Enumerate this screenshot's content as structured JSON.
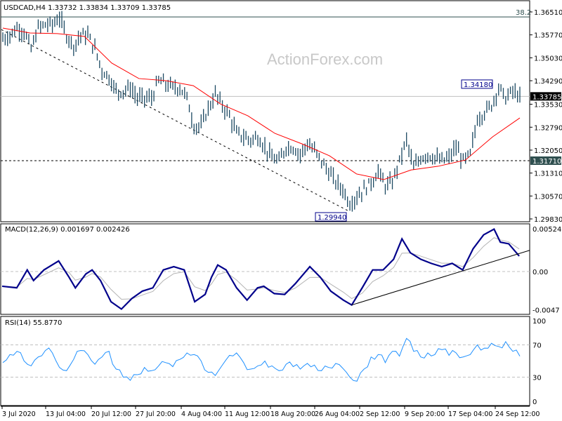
{
  "header": {
    "symbol_info": "USDCAD,H4  1.33732 1.33834 1.33709 1.33785"
  },
  "watermark": "ActionForex.com",
  "colors": {
    "bars": "#1d4a63",
    "ma": "#ff0000",
    "macd": "#00008b",
    "signal": "#b4b4b4",
    "rsi": "#1e90ff",
    "current_price_bg": "#000000",
    "level_bg": "#2f4f4f"
  },
  "chart_data": [
    {
      "type": "line",
      "title": "USDCAD,H4",
      "price_axis_ticks": [
        "1.36510",
        "1.35770",
        "1.35030",
        "1.34290",
        "1.33530",
        "1.32790",
        "1.32050",
        "1.31310",
        "1.30570",
        "1.29830"
      ],
      "price_axis_values": [
        1.3651,
        1.3577,
        1.3503,
        1.3429,
        1.3353,
        1.3279,
        1.3205,
        1.3131,
        1.3057,
        1.2983
      ],
      "ylim": [
        1.2983,
        1.3651
      ],
      "time_labels": [
        "3 Jul 2020",
        "13 Jul 04:00",
        "20 Jul 12:00",
        "27 Jul 20:00",
        "4 Aug 04:00",
        "11 Aug 12:00",
        "18 Aug 20:00",
        "26 Aug 04:00",
        "2 Sep 12:00",
        "9 Sep 20:00",
        "17 Sep 04:00",
        "24 Sep 12:00"
      ],
      "closes": [
        1.3565,
        1.3576,
        1.3599,
        1.3588,
        1.3531,
        1.3599,
        1.361,
        1.361,
        1.3633,
        1.3576,
        1.3542,
        1.3576,
        1.3576,
        1.3531,
        1.3463,
        1.344,
        1.3395,
        1.3395,
        1.3407,
        1.3373,
        1.3373,
        1.3373,
        1.3429,
        1.3418,
        1.3407,
        1.3407,
        1.3373,
        1.3282,
        1.3282,
        1.3339,
        1.3384,
        1.335,
        1.3316,
        1.3259,
        1.3248,
        1.3237,
        1.3248,
        1.3214,
        1.318,
        1.3169,
        1.3214,
        1.3214,
        1.3191,
        1.3225,
        1.3203,
        1.3169,
        1.3135,
        1.3101,
        1.3078,
        1.3033,
        1.3056,
        1.3078,
        1.3101,
        1.3135,
        1.309,
        1.3101,
        1.3169,
        1.3237,
        1.3146,
        1.318,
        1.3191,
        1.318,
        1.3169,
        1.318,
        1.3214,
        1.3169,
        1.3191,
        1.3305,
        1.3327,
        1.335,
        1.3407,
        1.3373,
        1.3395,
        1.3377
      ],
      "moving_average": [
        1.3599,
        1.3583,
        1.3581,
        1.3572,
        1.3486,
        1.3436,
        1.3429,
        1.3413,
        1.3354,
        1.3316,
        1.3259,
        1.3225,
        1.3187,
        1.3128,
        1.311,
        1.3141,
        1.3153,
        1.3173,
        1.3248,
        1.3309
      ],
      "current_price": {
        "label": "1.33785",
        "value": 1.33785
      },
      "level_line": {
        "label": "1.31710",
        "value": 1.3171
      },
      "fib_line": {
        "label": "38.2",
        "value": 1.3635
      },
      "high_annotation": {
        "label": "1.34180",
        "value": 1.3418
      },
      "low_annotation": {
        "label": "1.29940",
        "value": 1.2994
      },
      "trendline": {
        "from": 1.3594,
        "to": 1.301
      }
    },
    {
      "type": "line",
      "title": "MACD(12,26,9) 0.001697 0.002426",
      "axis_ticks": [
        "0.005245",
        "0.00",
        "-0.0047"
      ],
      "ylim": [
        -0.0047,
        0.005245
      ],
      "signal_period": 9,
      "macd": [
        [
          0,
          -0.0018
        ],
        [
          7,
          -0.002
        ],
        [
          12,
          0.0002
        ],
        [
          15,
          -0.0011
        ],
        [
          20,
          0.0002
        ],
        [
          27,
          0.0013
        ],
        [
          32,
          -0.0007
        ],
        [
          35,
          -0.002
        ],
        [
          40,
          -0.0003
        ],
        [
          43,
          0.0002
        ],
        [
          47,
          -0.0011
        ],
        [
          52,
          -0.0037
        ],
        [
          57,
          -0.0046
        ],
        [
          62,
          -0.0033
        ],
        [
          67,
          -0.0024
        ],
        [
          72,
          -0.002
        ],
        [
          77,
          0.0002
        ],
        [
          82,
          0.0006
        ],
        [
          87,
          0.0002
        ],
        [
          92,
          -0.0037
        ],
        [
          97,
          -0.0028
        ],
        [
          100,
          -0.0007
        ],
        [
          103,
          0.0008
        ],
        [
          107,
          0.0002
        ],
        [
          112,
          -0.002
        ],
        [
          117,
          -0.0035
        ],
        [
          122,
          -0.002
        ],
        [
          125,
          -0.0018
        ],
        [
          130,
          -0.0027
        ],
        [
          135,
          -0.0028
        ],
        [
          140,
          -0.0015
        ],
        [
          147,
          0.0006
        ],
        [
          152,
          -0.0007
        ],
        [
          157,
          -0.0024
        ],
        [
          163,
          -0.0035
        ],
        [
          167,
          -0.0041
        ],
        [
          172,
          -0.002
        ],
        [
          177,
          0.0002
        ],
        [
          182,
          0.0002
        ],
        [
          187,
          0.0015
        ],
        [
          191,
          0.004
        ],
        [
          195,
          0.0023
        ],
        [
          200,
          0.0015
        ],
        [
          205,
          0.001
        ],
        [
          210,
          0.0006
        ],
        [
          215,
          0.001
        ],
        [
          220,
          0.0002
        ],
        [
          225,
          0.0028
        ],
        [
          230,
          0.0045
        ],
        [
          235,
          0.0052
        ],
        [
          238,
          0.0036
        ],
        [
          242,
          0.0034
        ],
        [
          247,
          0.0019
        ]
      ],
      "trendline": {
        "from": [
          167,
          -0.0041
        ],
        "to": [
          252,
          0.0026
        ]
      }
    },
    {
      "type": "line",
      "title": "RSI(14) 55.8770",
      "axis_ticks": [
        "100",
        "70",
        "30",
        "0"
      ],
      "ylim": [
        0,
        100
      ],
      "levels": [
        70,
        30
      ],
      "values": [
        48,
        58,
        62,
        50,
        44,
        55,
        63,
        60,
        42,
        38,
        52,
        63,
        58,
        46,
        55,
        62,
        40,
        30,
        26,
        33,
        42,
        38,
        44,
        48,
        43,
        52,
        60,
        58,
        50,
        36,
        32,
        45,
        57,
        60,
        48,
        40,
        44,
        50,
        44,
        38,
        46,
        43,
        40,
        47,
        45,
        38,
        42,
        47,
        41,
        30,
        25,
        40,
        55,
        58,
        48,
        62,
        56,
        78,
        62,
        55,
        60,
        58,
        64,
        57,
        60,
        55,
        58,
        70,
        66,
        72,
        68,
        74,
        62,
        56
      ]
    }
  ]
}
